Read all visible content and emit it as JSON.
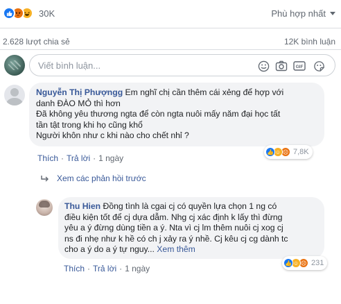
{
  "header": {
    "reaction_count": "30K",
    "sort_label": "Phù hợp nhất",
    "share_count": "2.628 lượt chia sẻ",
    "comment_count": "12K bình luận"
  },
  "composer": {
    "placeholder": "Viết bình luận...",
    "tools": [
      "emoji-icon",
      "camera-icon",
      "gif-icon",
      "sticker-icon"
    ]
  },
  "comments": [
    {
      "author": "Nguyễn Thị Phượngg",
      "lines": [
        "Em nghĩ chị cần thêm cái xẻng để hợp với",
        "danh ĐÀO MỎ thì hơn",
        "Đã không yêu thương ngta để còn ngta nuôi mấy năm đại học tất",
        "tần tật trong khi họ cũng khổ",
        "Người khôn như c khi nào cho chết nhỉ ?"
      ],
      "reactions_count": "7,8K",
      "like_label": "Thích",
      "reply_label": "Trả lời",
      "time": "1 ngày"
    }
  ],
  "previous_replies_label": "Xem các phản hồi trước",
  "reply": {
    "author": "Thu Hien",
    "lines": [
      "Đồng tình là cgai cj có quyền lựa chọn 1 ng có",
      "điều kiện tốt để cj dựa dẫm. Nhg cj xác định k lấy thì đừng",
      "yêu a ý đừng dùng tiền a ý. Nta vì cj lm thêm nuôi cj xog cj",
      "ns đi nhẹ như k hề có ch j xảy ra ý nhề. Cj kêu cj cg dành tc",
      "cho a ý do a ý tự nguy..."
    ],
    "see_more": "Xem thêm",
    "reactions_count": "231",
    "like_label": "Thích",
    "reply_label": "Trả lời",
    "time": "1 ngày"
  },
  "colors": {
    "link": "#385898",
    "bubble": "#f2f3f5",
    "like": "#1877f2",
    "haha": "#f7b125",
    "angry": "#e9710f"
  }
}
